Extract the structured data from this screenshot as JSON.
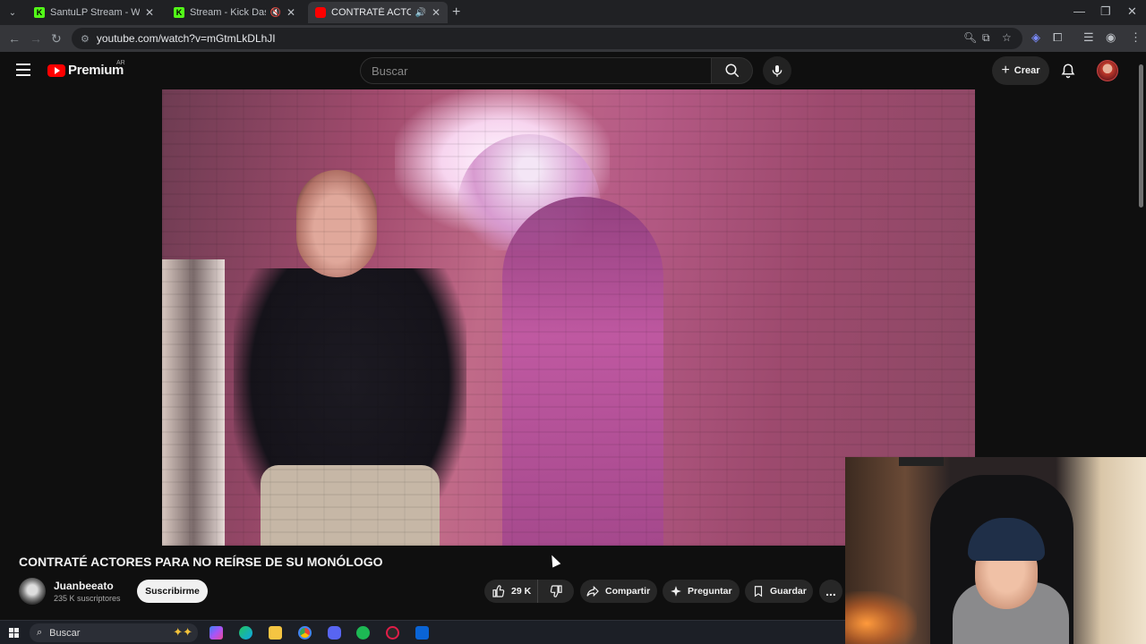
{
  "browser": {
    "tabs": [
      {
        "title": "SantuLP Stream - Watch Live on",
        "favicon": "kick-icon",
        "active": false
      },
      {
        "title": "Stream - Kick Dashboard",
        "favicon": "kick-icon",
        "active": false,
        "muted": true
      },
      {
        "title": "CONTRATÉ ACTORES PARA",
        "favicon": "youtube-icon",
        "active": true,
        "audio": true
      }
    ],
    "url": "youtube.com/watch?v=mGtmLkDLhJI"
  },
  "youtube": {
    "logo_text": "Premium",
    "country_code": "AR",
    "search_placeholder": "Buscar",
    "create_label": "Crear"
  },
  "video": {
    "title": "CONTRATÉ ACTORES PARA NO REÍRSE DE SU MONÓLOGO",
    "channel_name": "Juanbeeato",
    "subscribers": "235 K suscriptores",
    "subscribe_label": "Suscribirme",
    "likes": "29 K",
    "share_label": "Compartir",
    "ask_label": "Preguntar",
    "save_label": "Guardar",
    "more_label": "..."
  },
  "taskbar": {
    "search_placeholder": "Buscar"
  },
  "colors": {
    "accent": "#ff0000",
    "background": "#0f0f0f",
    "kick": "#53fc18"
  }
}
